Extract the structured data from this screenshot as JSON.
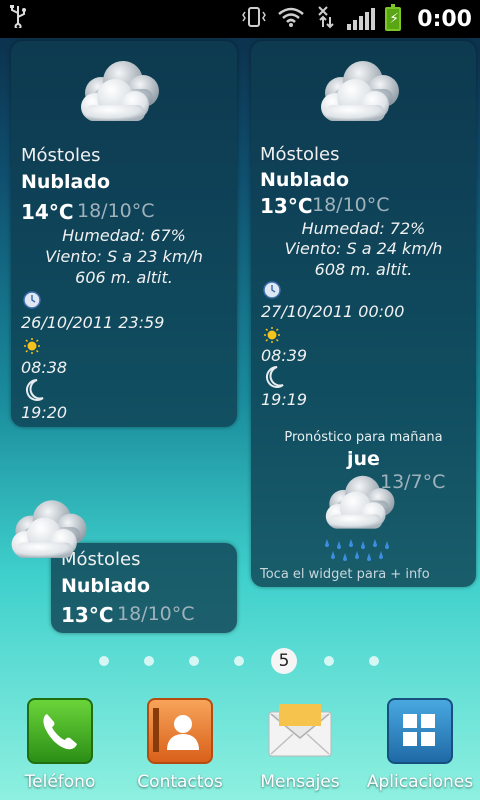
{
  "status_bar": {
    "usb_icon": "usb-icon",
    "vibrate_icon": "vibrate-icon",
    "wifi_icon": "wifi-icon",
    "data_icon": "data-transfer-icon",
    "signal_icon": "signal-bars-icon",
    "battery_icon": "battery-charging-icon",
    "time": "0:00"
  },
  "widget_left": {
    "city": "Móstoles",
    "condition": "Nublado",
    "temp": "14°C",
    "range": "18/10°C",
    "humidity": "Humedad: 67%",
    "wind": "Viento: S a 23 km/h",
    "altitude": "606 m. altit.",
    "updated": "26/10/2011  23:59",
    "sunrise": "08:38",
    "sunset": "19:20"
  },
  "widget_right": {
    "city": "Móstoles",
    "condition": "Nublado",
    "temp": "13°C",
    "range": "18/10°C",
    "humidity": "Humedad: 72%",
    "wind": "Viento: S a 24 km/h",
    "altitude": "608 m. altit.",
    "updated": "27/10/2011  00:00",
    "sunrise": "08:39",
    "sunset": "19:19",
    "forecast_title": "Pronóstico para mañana",
    "forecast_day": "jue",
    "forecast_range": "13/7°C",
    "footer": "Toca el widget para + info"
  },
  "widget_small": {
    "city": "Móstoles",
    "condition": "Nublado",
    "temp": "13°C",
    "range": "18/10°C"
  },
  "page_indicator": {
    "current": "5",
    "total_dots": 7
  },
  "dock": {
    "items": [
      {
        "label": "Teléfono",
        "icon": "phone-icon"
      },
      {
        "label": "Contactos",
        "icon": "contacts-icon"
      },
      {
        "label": "Mensajes",
        "icon": "messages-icon"
      },
      {
        "label": "Aplicaciones",
        "icon": "apps-grid-icon"
      }
    ]
  },
  "colors": {
    "widget_bg": "#0e3c50",
    "range_text": "#9fb2bb",
    "phone_green": "#3aa020",
    "contacts_orange": "#e8731c",
    "apps_blue": "#2a7fb8"
  }
}
